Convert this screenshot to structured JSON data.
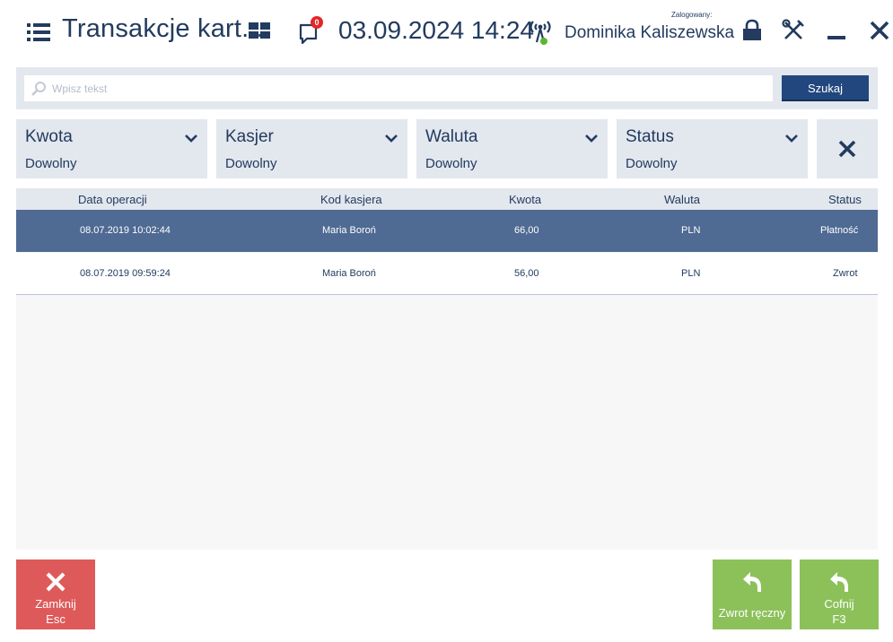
{
  "header": {
    "title": "Transakcje kart...",
    "notifications_count": "0",
    "datetime": "03.09.2024 14:24",
    "logged_label": "Zalogowany:",
    "username": "Dominika Kaliszewska",
    "icons": [
      "menu-icon",
      "tiles-icon",
      "notification-icon",
      "signal-icon",
      "lock-icon",
      "tools-icon",
      "minimize-icon",
      "close-icon"
    ]
  },
  "search": {
    "placeholder": "Wpisz tekst",
    "value": "",
    "button_label": "Szukaj"
  },
  "filters": [
    {
      "label": "Kwota",
      "value": "Dowolny"
    },
    {
      "label": "Kasjer",
      "value": "Dowolny"
    },
    {
      "label": "Waluta",
      "value": "Dowolny"
    },
    {
      "label": "Status",
      "value": "Dowolny"
    }
  ],
  "table": {
    "columns": [
      "Data operacji",
      "Kod kasjera",
      "Kwota",
      "Waluta",
      "Status"
    ],
    "rows": [
      {
        "date": "08.07.2019 10:02:44",
        "cashier": "Maria Boroń",
        "amount": "66,00",
        "currency": "PLN",
        "status": "Płatność",
        "selected": true
      },
      {
        "date": "08.07.2019 09:59:24",
        "cashier": "Maria Boroń",
        "amount": "56,00",
        "currency": "PLN",
        "status": "Zwrot",
        "selected": false
      }
    ]
  },
  "buttons": {
    "close": {
      "label": "Zamknij",
      "shortcut": "Esc"
    },
    "manual_refund": {
      "label": "Zwrot ręczny"
    },
    "back": {
      "label": "Cofnij",
      "shortcut": "F3"
    }
  },
  "colors": {
    "primary": "#223b5f",
    "accent_button": "#22477f",
    "selected_row": "#4f6a93",
    "close_button": "#de5a5a",
    "action_button": "#8cc15a",
    "panel": "#e3e7ee",
    "badge": "#e32626"
  }
}
